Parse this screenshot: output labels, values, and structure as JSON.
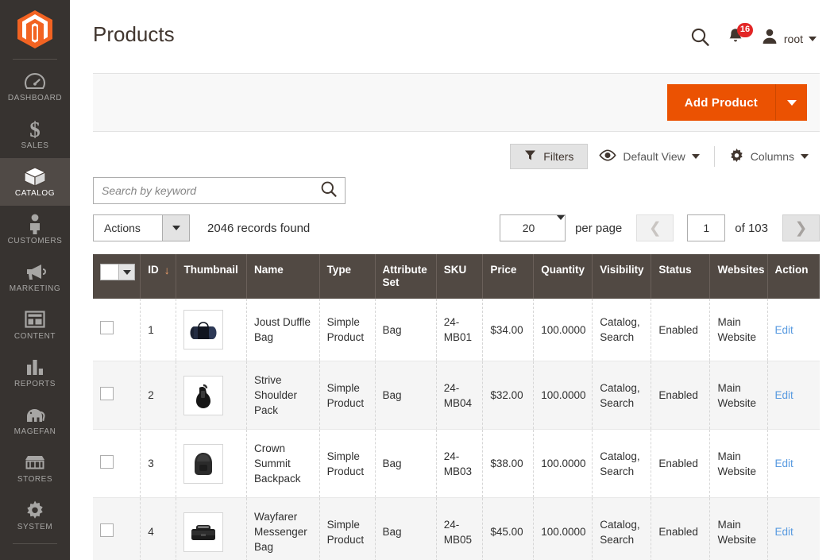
{
  "sidebar": {
    "logo": "magento-logo-icon",
    "items": [
      {
        "label": "DASHBOARD",
        "icon": "dashboard-icon",
        "active": false
      },
      {
        "label": "SALES",
        "icon": "dollar-icon",
        "active": false
      },
      {
        "label": "CATALOG",
        "icon": "box-icon",
        "active": true
      },
      {
        "label": "CUSTOMERS",
        "icon": "person-icon",
        "active": false
      },
      {
        "label": "MARKETING",
        "icon": "megaphone-icon",
        "active": false
      },
      {
        "label": "CONTENT",
        "icon": "layout-icon",
        "active": false
      },
      {
        "label": "REPORTS",
        "icon": "bar-chart-icon",
        "active": false
      },
      {
        "label": "MAGEFAN",
        "icon": "elephant-icon",
        "active": false
      },
      {
        "label": "STORES",
        "icon": "storefront-icon",
        "active": false
      },
      {
        "label": "SYSTEM",
        "icon": "gear-icon",
        "active": false
      }
    ]
  },
  "header": {
    "title": "Products",
    "search_icon": "search-icon",
    "notifications": {
      "icon": "bell-icon",
      "count": "16"
    },
    "user": {
      "icon": "user-avatar-icon",
      "name": "root",
      "caret": "chevron-down-icon"
    }
  },
  "page_actions": {
    "add_product_label": "Add Product",
    "add_product_caret": "chevron-down-icon",
    "accent_color": "#eb5202"
  },
  "grid_controls": {
    "filters_label": "Filters",
    "filters_icon": "funnel-icon",
    "view_icon": "eye-icon",
    "view_label": "Default View",
    "columns_icon": "gear-icon",
    "columns_label": "Columns"
  },
  "search": {
    "placeholder": "Search by keyword",
    "value": "",
    "icon": "search-icon"
  },
  "toolbar": {
    "actions_label": "Actions",
    "records_found": "2046 records found"
  },
  "pagination": {
    "per_page_value": "20",
    "per_page_label": "per page",
    "prev_icon": "chevron-left-icon",
    "next_icon": "chevron-right-icon",
    "current_page": "1",
    "of_label": "of 103"
  },
  "table": {
    "select_all": "select-all-checkbox",
    "sort_column": "ID",
    "sort_arrow": "↓",
    "columns": [
      "ID",
      "Thumbnail",
      "Name",
      "Type",
      "Attribute Set",
      "SKU",
      "Price",
      "Quantity",
      "Visibility",
      "Status",
      "Websites",
      "Action"
    ],
    "rows": [
      {
        "id": "1",
        "thumbnail": "duffle-bag-thumbnail",
        "name": "Joust Duffle Bag",
        "type": "Simple Product",
        "attribute_set": "Bag",
        "sku": "24-MB01",
        "price": "$34.00",
        "quantity": "100.0000",
        "visibility": "Catalog, Search",
        "status": "Enabled",
        "websites": "Main Website",
        "action": "Edit"
      },
      {
        "id": "2",
        "thumbnail": "shoulder-pack-thumbnail",
        "name": "Strive Shoulder Pack",
        "type": "Simple Product",
        "attribute_set": "Bag",
        "sku": "24-MB04",
        "price": "$32.00",
        "quantity": "100.0000",
        "visibility": "Catalog, Search",
        "status": "Enabled",
        "websites": "Main Website",
        "action": "Edit"
      },
      {
        "id": "3",
        "thumbnail": "backpack-thumbnail",
        "name": "Crown Summit Backpack",
        "type": "Simple Product",
        "attribute_set": "Bag",
        "sku": "24-MB03",
        "price": "$38.00",
        "quantity": "100.0000",
        "visibility": "Catalog, Search",
        "status": "Enabled",
        "websites": "Main Website",
        "action": "Edit"
      },
      {
        "id": "4",
        "thumbnail": "messenger-bag-thumbnail",
        "name": "Wayfarer Messenger Bag",
        "type": "Simple Product",
        "attribute_set": "Bag",
        "sku": "24-MB05",
        "price": "$45.00",
        "quantity": "100.0000",
        "visibility": "Catalog, Search",
        "status": "Enabled",
        "websites": "Main Website",
        "action": "Edit"
      }
    ]
  }
}
